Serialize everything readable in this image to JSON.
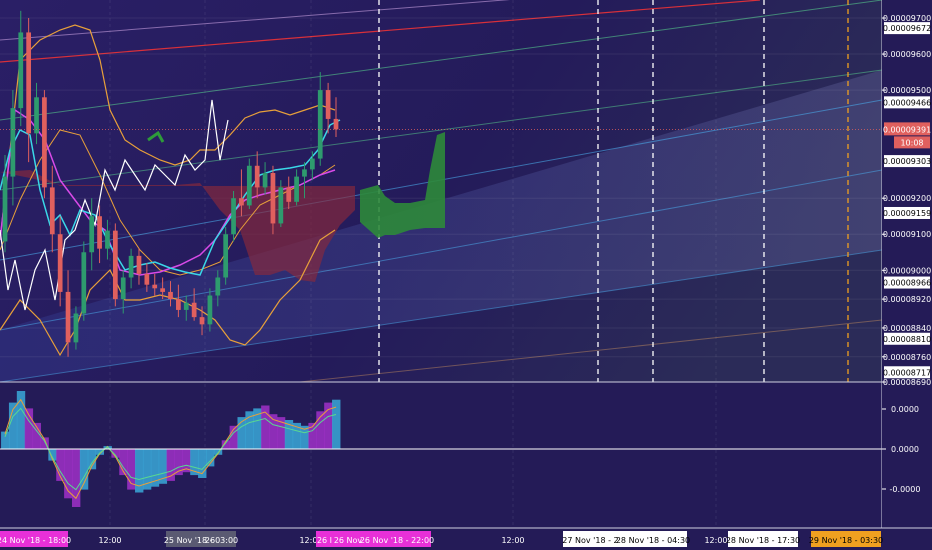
{
  "colors": {
    "background": "#241b57",
    "candle_up": "#2e9b6e",
    "candle_down": "#e0605e",
    "kumo_bear": "#8a2a3a",
    "kumo_bull": "#2e8a3a",
    "bollinger": "#e8a03a",
    "conversion": "#3ad8e8",
    "base": "#d84ae8",
    "lagging": "#ffffff",
    "red_trend": "#d8303a",
    "green_trend": "#5ad890",
    "magenta_tag": "#e830d8",
    "orange_tag": "#f0a020"
  },
  "price_axis": {
    "ticks": [
      "0.00009700",
      "0.00009600",
      "0.00009500",
      "0.00009200",
      "0.00009100",
      "0.00009000",
      "0.00008920",
      "0.00008840",
      "0.00008760",
      "0.00008690"
    ],
    "boxed": [
      "0.00009672",
      "0.00009466",
      "0.00009303",
      "0.00009159",
      "0.00008966",
      "0.00008810",
      "0.00008717"
    ],
    "current_price": "0.00009391",
    "countdown": "10:08"
  },
  "oscillator_axis": {
    "ticks": [
      "0.0000",
      "0.0000",
      "-0.0000"
    ]
  },
  "time_axis": {
    "ticks": [
      "12:00",
      "12:00",
      "12:00",
      "12:00"
    ],
    "tags": [
      {
        "text": "24 Nov '18 - 18:00",
        "style": "magenta"
      },
      {
        "text": "25 Nov '18 - 03:00",
        "style": "gray"
      },
      {
        "text": "26",
        "style": "plain"
      },
      {
        "text": "26 I",
        "style": "magenta"
      },
      {
        "text": "26 Nov",
        "style": "magenta"
      },
      {
        "text": "26 Nov '18 - 22:00",
        "style": "magenta"
      },
      {
        "text": "27 Nov '18 - 22",
        "style": "white"
      },
      {
        "text": "28 Nov '18 - 04:30",
        "style": "white"
      },
      {
        "text": "28 Nov '18 - 17:30",
        "style": "white"
      },
      {
        "text": "29 Nov '18 - 03:30",
        "style": "orange"
      }
    ]
  },
  "chart_data": {
    "type": "candlestick",
    "y_range": [
      8.69e-05,
      9.75e-05
    ],
    "current_price": 9.391e-05,
    "candles": [
      [
        9.08e-05,
        9.32e-05,
        9.05e-05,
        9.26e-05
      ],
      [
        9.26e-05,
        9.5e-05,
        9.18e-05,
        9.45e-05
      ],
      [
        9.45e-05,
        9.72e-05,
        9.4e-05,
        9.66e-05
      ],
      [
        9.66e-05,
        9.7e-05,
        9.3e-05,
        9.38e-05
      ],
      [
        9.38e-05,
        9.52e-05,
        9.35e-05,
        9.48e-05
      ],
      [
        9.48e-05,
        9.5e-05,
        9.2e-05,
        9.23e-05
      ],
      [
        9.23e-05,
        9.29e-05,
        9.05e-05,
        9.1e-05
      ],
      [
        9.1e-05,
        9.15e-05,
        8.9e-05,
        8.94e-05
      ],
      [
        8.94e-05,
        9e-05,
        8.76e-05,
        8.8e-05
      ],
      [
        8.8e-05,
        8.9e-05,
        8.78e-05,
        8.88e-05
      ],
      [
        8.88e-05,
        9.08e-05,
        8.86e-05,
        9.05e-05
      ],
      [
        9.05e-05,
        9.2e-05,
        9e-05,
        9.15e-05
      ],
      [
        9.15e-05,
        9.18e-05,
        9.02e-05,
        9.06e-05
      ],
      [
        9.06e-05,
        9.14e-05,
        9.03e-05,
        9.11e-05
      ],
      [
        9.11e-05,
        9.13e-05,
        8.9e-05,
        8.92e-05
      ],
      [
        8.92e-05,
        9e-05,
        8.88e-05,
        8.98e-05
      ],
      [
        8.98e-05,
        9.06e-05,
        8.95e-05,
        9.04e-05
      ],
      [
        9.04e-05,
        9.06e-05,
        8.96e-05,
        8.99e-05
      ],
      [
        8.99e-05,
        9.02e-05,
        8.94e-05,
        8.96e-05
      ],
      [
        8.96e-05,
        8.99e-05,
        8.93e-05,
        8.95e-05
      ],
      [
        8.95e-05,
        8.98e-05,
        8.92e-05,
        8.94e-05
      ],
      [
        8.94e-05,
        8.97e-05,
        8.9e-05,
        8.92e-05
      ],
      [
        8.92e-05,
        8.96e-05,
        8.87e-05,
        8.89e-05
      ],
      [
        8.89e-05,
        8.93e-05,
        8.86e-05,
        8.91e-05
      ],
      [
        8.91e-05,
        8.95e-05,
        8.86e-05,
        8.87e-05
      ],
      [
        8.87e-05,
        8.9e-05,
        8.82e-05,
        8.85e-05
      ],
      [
        8.85e-05,
        8.95e-05,
        8.83e-05,
        8.93e-05
      ],
      [
        8.93e-05,
        9e-05,
        8.9e-05,
        8.98e-05
      ],
      [
        8.98e-05,
        9.12e-05,
        8.96e-05,
        9.1e-05
      ],
      [
        9.1e-05,
        9.22e-05,
        9.08e-05,
        9.2e-05
      ],
      [
        9.2e-05,
        9.28e-05,
        9.15e-05,
        9.18e-05
      ],
      [
        9.18e-05,
        9.31e-05,
        9.17e-05,
        9.29e-05
      ],
      [
        9.29e-05,
        9.33e-05,
        9.2e-05,
        9.23e-05
      ],
      [
        9.23e-05,
        9.3e-05,
        9.21e-05,
        9.27e-05
      ],
      [
        9.27e-05,
        9.29e-05,
        9.1e-05,
        9.13e-05
      ],
      [
        9.13e-05,
        9.25e-05,
        9.12e-05,
        9.23e-05
      ],
      [
        9.23e-05,
        9.26e-05,
        9.17e-05,
        9.19e-05
      ],
      [
        9.19e-05,
        9.28e-05,
        9.18e-05,
        9.26e-05
      ],
      [
        9.26e-05,
        9.3e-05,
        9.2e-05,
        9.28e-05
      ],
      [
        9.28e-05,
        9.33e-05,
        9.25e-05,
        9.31e-05
      ],
      [
        9.31e-05,
        9.55e-05,
        9.29e-05,
        9.5e-05
      ],
      [
        9.5e-05,
        9.52e-05,
        9.38e-05,
        9.42e-05
      ],
      [
        9.42e-05,
        9.48e-05,
        9.37e-05,
        9.391e-05
      ]
    ],
    "vertical_markers": [
      {
        "time": "26 Nov '18 - 22:00",
        "color": "#ffffff",
        "dashed": true
      },
      {
        "time": "27 Nov '18 - 22",
        "color": "#ffffff",
        "dashed": true
      },
      {
        "time": "28 Nov '18 - 04:30",
        "color": "#ffffff",
        "dashed": true
      },
      {
        "time": "28 Nov '18 - 17:30",
        "color": "#ffffff",
        "dashed": true
      },
      {
        "time": "29 Nov '18 - 03:30",
        "color": "#f0a020",
        "dashed": true
      }
    ],
    "oscillator": {
      "zero": "0.0000",
      "histogram": [
        0.3,
        0.8,
        1.0,
        0.7,
        0.45,
        0.2,
        -0.2,
        -0.55,
        -0.85,
        -1.0,
        -0.7,
        -0.35,
        -0.1,
        0.05,
        -0.15,
        -0.45,
        -0.7,
        -0.75,
        -0.7,
        -0.65,
        -0.6,
        -0.55,
        -0.45,
        -0.4,
        -0.45,
        -0.5,
        -0.3,
        -0.1,
        0.15,
        0.4,
        0.55,
        0.65,
        0.7,
        0.75,
        0.6,
        0.55,
        0.5,
        0.45,
        0.4,
        0.45,
        0.65,
        0.8,
        0.85
      ]
    }
  }
}
